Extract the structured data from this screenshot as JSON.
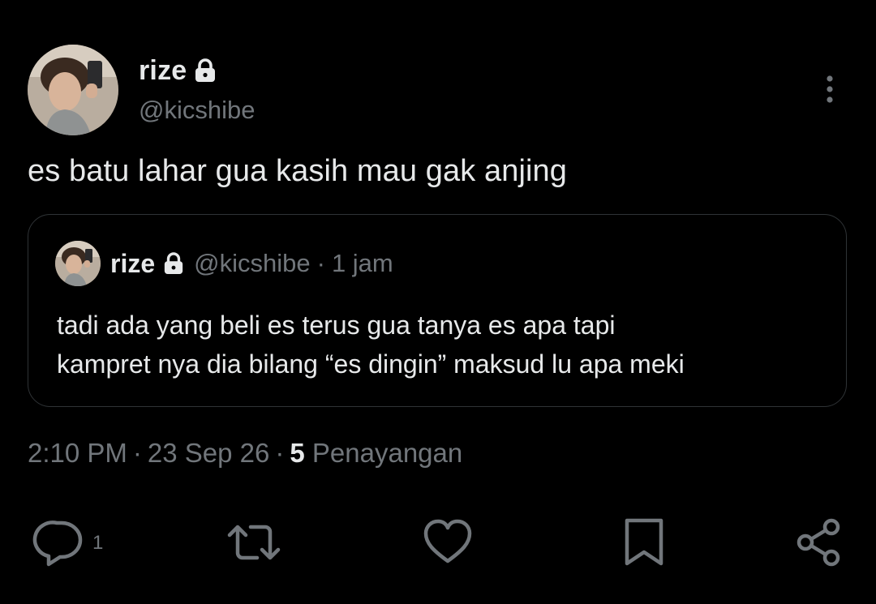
{
  "author": {
    "display_name": "rize",
    "handle": "@kicshibe",
    "avatar_icon": "profile-photo-avatar",
    "protected_icon": "lock-icon"
  },
  "tweet": {
    "text": "es batu lahar gua kasih mau gak anjing"
  },
  "quote": {
    "display_name": "rize",
    "handle": "@kicshibe",
    "separator": "·",
    "time": "1 jam",
    "lines": [
      "tadi ada yang beli es terus gua tanya es apa tapi",
      "kampret nya dia bilang “es dingin” maksud lu apa meki"
    ]
  },
  "meta": {
    "time": "2:10 PM",
    "separator": "·",
    "date": "23 Sep 26",
    "views_count": "5",
    "views_label": "Penayangan"
  },
  "actions": {
    "reply_count": "1",
    "icons": [
      "reply-icon",
      "retweet-icon",
      "like-icon",
      "bookmark-icon",
      "share-icon"
    ]
  },
  "colors": {
    "background": "#000000",
    "primary_text": "#e7e9ea",
    "secondary_text": "#71767b",
    "border": "#2f3336"
  }
}
